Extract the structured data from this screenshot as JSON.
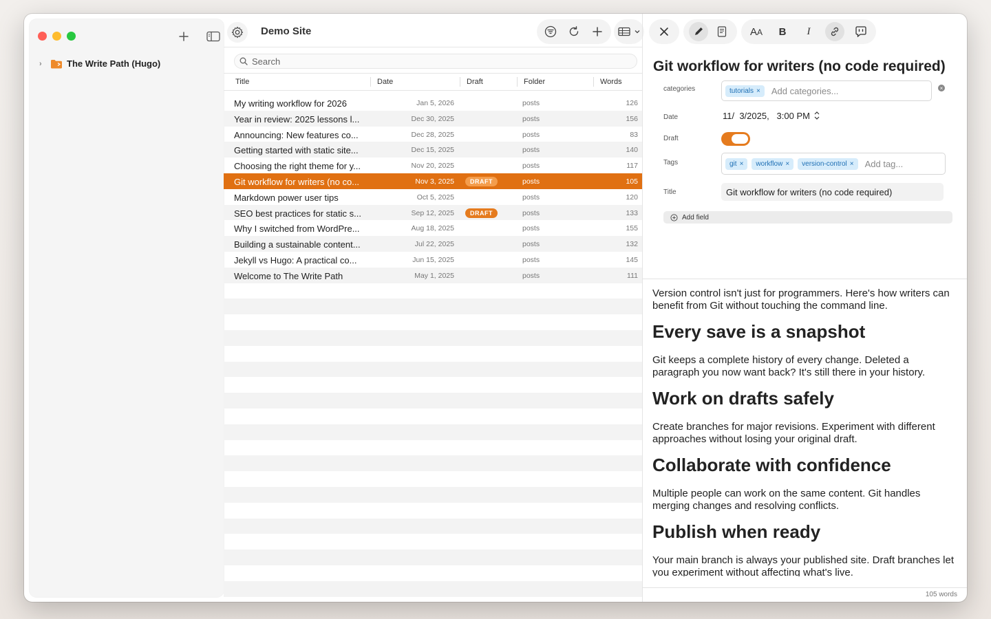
{
  "sidebar": {
    "tree": [
      {
        "label": "The Write Path (Hugo)"
      }
    ]
  },
  "header": {
    "site_title": "Demo Site"
  },
  "search": {
    "placeholder": "Search"
  },
  "table": {
    "columns": [
      "Title",
      "Date",
      "Draft",
      "Folder",
      "Words"
    ],
    "rows": [
      {
        "title": "My writing workflow for 2026",
        "date": "Jan 5, 2026",
        "draft": "",
        "folder": "posts",
        "words": "126"
      },
      {
        "title": "Year in review: 2025 lessons l...",
        "date": "Dec 30, 2025",
        "draft": "",
        "folder": "posts",
        "words": "156"
      },
      {
        "title": "Announcing: New features co...",
        "date": "Dec 28, 2025",
        "draft": "",
        "folder": "posts",
        "words": "83"
      },
      {
        "title": "Getting started with static site...",
        "date": "Dec 15, 2025",
        "draft": "",
        "folder": "posts",
        "words": "140"
      },
      {
        "title": "Choosing the right theme for y...",
        "date": "Nov 20, 2025",
        "draft": "",
        "folder": "posts",
        "words": "117"
      },
      {
        "title": "Git workflow for writers (no co...",
        "date": "Nov 3, 2025",
        "draft": "DRAFT",
        "folder": "posts",
        "words": "105"
      },
      {
        "title": "Markdown power user tips",
        "date": "Oct 5, 2025",
        "draft": "",
        "folder": "posts",
        "words": "120"
      },
      {
        "title": "SEO best practices for static s...",
        "date": "Sep 12, 2025",
        "draft": "DRAFT",
        "folder": "posts",
        "words": "133"
      },
      {
        "title": "Why I switched from WordPre...",
        "date": "Aug 18, 2025",
        "draft": "",
        "folder": "posts",
        "words": "155"
      },
      {
        "title": "Building a sustainable content...",
        "date": "Jul 22, 2025",
        "draft": "",
        "folder": "posts",
        "words": "132"
      },
      {
        "title": "Jekyll vs Hugo: A practical co...",
        "date": "Jun 15, 2025",
        "draft": "",
        "folder": "posts",
        "words": "145"
      },
      {
        "title": "Welcome to The Write Path",
        "date": "May 1, 2025",
        "draft": "",
        "folder": "posts",
        "words": "111"
      }
    ],
    "selected_index": 5
  },
  "editor": {
    "title": "Git workflow for writers (no code required)",
    "frontmatter": {
      "categories_label": "categories",
      "categories": [
        "tutorials"
      ],
      "categories_placeholder": "Add categories...",
      "date_label": "Date",
      "date_value": "11/  3/2025,   3:00 PM",
      "draft_label": "Draft",
      "draft_on": true,
      "tags_label": "Tags",
      "tags": [
        "git",
        "workflow",
        "version-control"
      ],
      "tags_placeholder": "Add tag...",
      "title_label": "Title",
      "title_value": "Git workflow for writers (no code required)",
      "add_field_label": "Add field"
    },
    "body": {
      "intro": "Version control isn't just for programmers. Here's how writers can benefit from Git without touching the command line.",
      "h1": "Every save is a snapshot",
      "p1": "Git keeps a complete history of every change. Deleted a paragraph you now want back? It's still there in your history.",
      "h2": "Work on drafts safely",
      "p2": "Create branches for major revisions. Experiment with different approaches without losing your original draft.",
      "h3": "Collaborate with confidence",
      "p3": "Multiple people can work on the same content. Git handles merging changes and resolving conflicts.",
      "h4": "Publish when ready",
      "p4": "Your main branch is always your published site. Draft branches let you experiment without affecting what's live."
    },
    "word_count": "105 words"
  },
  "colors": {
    "accent": "#e07012",
    "chip_bg": "#d6ecfb",
    "chip_text": "#1e6fb4"
  }
}
